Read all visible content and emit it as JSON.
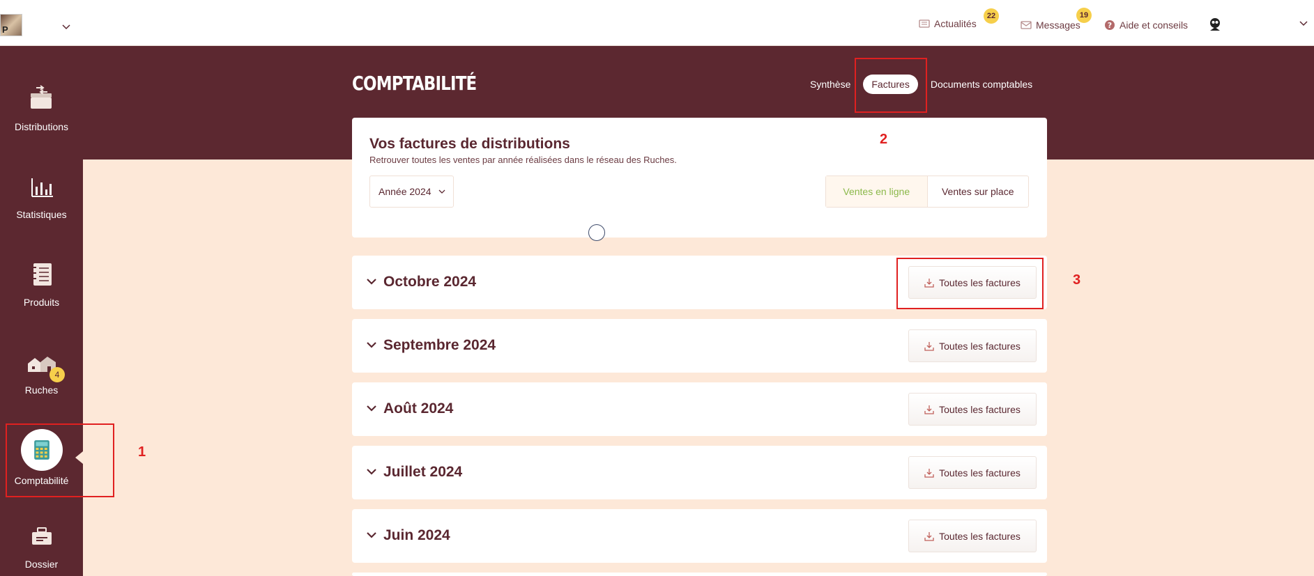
{
  "topbar": {
    "avatar_letter": "P",
    "news_label": "Actualités",
    "news_count": "22",
    "messages_label": "Messages",
    "messages_count": "19",
    "help_label": "Aide et conseils"
  },
  "sidebar": {
    "items": [
      {
        "label": "Distributions"
      },
      {
        "label": "Statistiques"
      },
      {
        "label": "Produits"
      },
      {
        "label": "Ruches",
        "badge": "4"
      },
      {
        "label": "Comptabilité"
      },
      {
        "label": "Dossier"
      }
    ]
  },
  "header": {
    "title": "COMPTABILITÉ",
    "tabs": [
      {
        "label": "Synthèse"
      },
      {
        "label": "Factures"
      },
      {
        "label": "Documents comptables"
      }
    ]
  },
  "card": {
    "title": "Vos factures de distributions",
    "subtitle": "Retrouver toutes les ventes par année réalisées dans le réseau des Ruches.",
    "year_selected": "Année 2024",
    "segments": [
      {
        "label": "Ventes en ligne"
      },
      {
        "label": "Ventes sur place"
      }
    ]
  },
  "months": [
    {
      "label": "Octobre 2024",
      "button": "Toutes les factures"
    },
    {
      "label": "Septembre 2024",
      "button": "Toutes les factures"
    },
    {
      "label": "Août 2024",
      "button": "Toutes les factures"
    },
    {
      "label": "Juillet 2024",
      "button": "Toutes les factures"
    },
    {
      "label": "Juin 2024",
      "button": "Toutes les factures"
    }
  ],
  "annotations": [
    "1",
    "2",
    "3"
  ],
  "colors": {
    "brand": "#5c2830",
    "background": "#fde8d8",
    "accent_green": "#8bb84a",
    "badge_yellow": "#f6cf4b",
    "annotation_red": "#e02020"
  }
}
